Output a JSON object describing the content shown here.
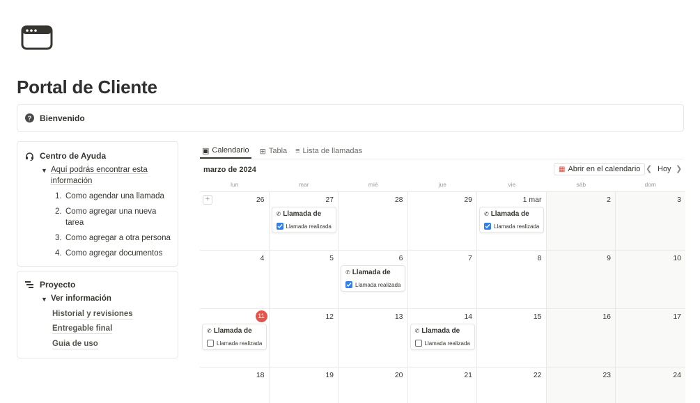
{
  "page": {
    "title": "Portal de Cliente",
    "icon": "browser-window-icon"
  },
  "callout": {
    "icon": "question-circle-icon",
    "text": "Bienvenido"
  },
  "help_box": {
    "icon": "headset-icon",
    "title": "Centro de Ayuda",
    "toggle_title": "Aquí podrás encontrar esta información",
    "items": [
      {
        "num": "1.",
        "label": "Como agendar una llamada"
      },
      {
        "num": "2.",
        "label": "Como agregar una nueva tarea"
      },
      {
        "num": "3.",
        "label": "Como agregar a otra persona"
      },
      {
        "num": "4.",
        "label": "Como agregar documentos"
      }
    ]
  },
  "project_box": {
    "icon": "timeline-icon",
    "title": "Proyecto",
    "toggle_title": "Ver información",
    "links": [
      "Historial y revisiones",
      "Entregable final",
      "Guia de uso"
    ]
  },
  "tabs": [
    {
      "label": "Calendario",
      "icon": "calendar-icon",
      "active": true
    },
    {
      "label": "Tabla",
      "icon": "table-icon",
      "active": false
    },
    {
      "label": "Lista de llamadas",
      "icon": "list-icon",
      "active": false
    }
  ],
  "calendar": {
    "month_label": "marzo de 2024",
    "open_button": "Abrir en el calendario",
    "today_label": "Hoy",
    "weekdays": [
      "lun",
      "mar",
      "mié",
      "jue",
      "vie",
      "sáb",
      "dom"
    ],
    "weeks": [
      [
        "26",
        "27",
        "28",
        "29",
        "1 mar",
        "2",
        "3"
      ],
      [
        "4",
        "5",
        "6",
        "7",
        "8",
        "9",
        "10"
      ],
      [
        "11",
        "12",
        "13",
        "14",
        "15",
        "16",
        "17"
      ],
      [
        "18",
        "19",
        "20",
        "21",
        "22",
        "23",
        "24"
      ]
    ],
    "today": "11",
    "events": [
      {
        "title": "Llamada de",
        "checkbox_label": "Llamada realizada",
        "done": true
      },
      {
        "title": "Llamada de",
        "checkbox_label": "Llamada realizada",
        "done": true
      },
      {
        "title": "Llamada de",
        "checkbox_label": "Llamada realizada",
        "done": true
      },
      {
        "title": "Llamada de",
        "checkbox_label": "Llamada realizada",
        "done": false
      },
      {
        "title": "Llamada de",
        "checkbox_label": "Llamada realizada",
        "done": false
      }
    ],
    "colors": {
      "today_badge": "#e5534b",
      "checkbox_on": "#2f80ed",
      "calendar_icon": "#d9493b"
    }
  }
}
